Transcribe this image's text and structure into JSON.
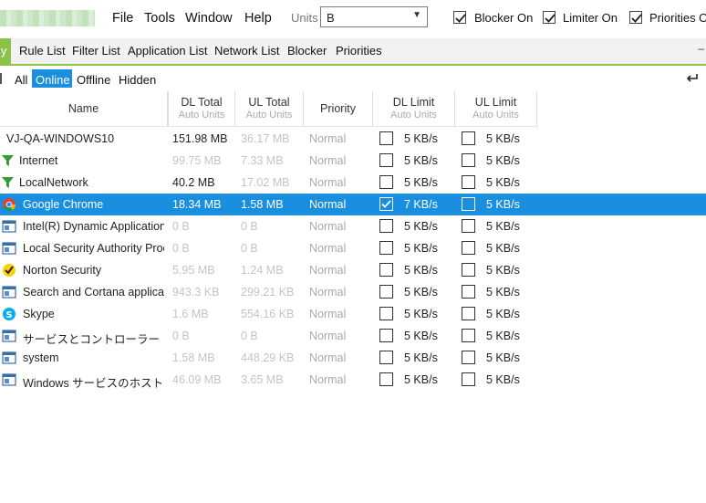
{
  "menu": {
    "file": "File",
    "tools": "Tools",
    "window": "Window",
    "help": "Help"
  },
  "units": {
    "label": "Units",
    "value": "B"
  },
  "toggles": {
    "blocker": "Blocker On",
    "limiter": "Limiter On",
    "priorities": "Priorities On"
  },
  "tabs": {
    "active_fragment": "y",
    "items": [
      "Rule List",
      "Filter List",
      "Application List",
      "Network List",
      "Blocker",
      "Priorities"
    ]
  },
  "filters": {
    "all": "All",
    "online": "Online",
    "offline": "Offline",
    "hidden": "Hidden"
  },
  "columns": {
    "name": "Name",
    "dl_total": "DL Total",
    "dl_total_sub": "Auto Units",
    "ul_total": "UL Total",
    "ul_total_sub": "Auto Units",
    "priority": "Priority",
    "dl_limit": "DL Limit",
    "dl_limit_sub": "Auto Units",
    "ul_limit": "UL Limit",
    "ul_limit_sub": "Auto Units"
  },
  "rows": [
    {
      "name": "VJ-QA-WINDOWS10",
      "icon": "none",
      "dl": "151.98 MB",
      "ul": "36.17 MB",
      "priority": "Normal",
      "dl_checked": false,
      "dl_limit": "5 KB/s",
      "ul_checked": false,
      "ul_limit": "5 KB/s",
      "selected": false,
      "dl_dim": false
    },
    {
      "name": "Internet",
      "icon": "filter-icon",
      "dl": "99.75 MB",
      "ul": "7.33 MB",
      "priority": "Normal",
      "dl_checked": false,
      "dl_limit": "5 KB/s",
      "ul_checked": false,
      "ul_limit": "5 KB/s",
      "selected": false,
      "dl_dim": true
    },
    {
      "name": "LocalNetwork",
      "icon": "filter-icon",
      "dl": "40.2 MB",
      "ul": "17.02 MB",
      "priority": "Normal",
      "dl_checked": false,
      "dl_limit": "5 KB/s",
      "ul_checked": false,
      "ul_limit": "5 KB/s",
      "selected": false,
      "dl_dim": false
    },
    {
      "name": "Google Chrome",
      "icon": "chrome-icon",
      "dl": "18.34 MB",
      "ul": "1.58 MB",
      "priority": "Normal",
      "dl_checked": true,
      "dl_limit": "7 KB/s",
      "ul_checked": false,
      "ul_limit": "5 KB/s",
      "selected": true,
      "dl_dim": false
    },
    {
      "name": "Intel(R) Dynamic Application",
      "icon": "app-window-icon",
      "dl": "0 B",
      "ul": "0 B",
      "priority": "Normal",
      "dl_checked": false,
      "dl_limit": "5 KB/s",
      "ul_checked": false,
      "ul_limit": "5 KB/s",
      "selected": false,
      "dl_dim": true
    },
    {
      "name": "Local Security Authority Proc",
      "icon": "app-window-icon",
      "dl": "0 B",
      "ul": "0 B",
      "priority": "Normal",
      "dl_checked": false,
      "dl_limit": "5 KB/s",
      "ul_checked": false,
      "ul_limit": "5 KB/s",
      "selected": false,
      "dl_dim": true
    },
    {
      "name": "Norton Security",
      "icon": "norton-icon",
      "dl": "5.95 MB",
      "ul": "1.24 MB",
      "priority": "Normal",
      "dl_checked": false,
      "dl_limit": "5 KB/s",
      "ul_checked": false,
      "ul_limit": "5 KB/s",
      "selected": false,
      "dl_dim": true
    },
    {
      "name": "Search and Cortana applicati",
      "icon": "app-window-icon",
      "dl": "943.3 KB",
      "ul": "299.21 KB",
      "priority": "Normal",
      "dl_checked": false,
      "dl_limit": "5 KB/s",
      "ul_checked": false,
      "ul_limit": "5 KB/s",
      "selected": false,
      "dl_dim": true
    },
    {
      "name": "Skype",
      "icon": "skype-icon",
      "dl": "1.6 MB",
      "ul": "554.16 KB",
      "priority": "Normal",
      "dl_checked": false,
      "dl_limit": "5 KB/s",
      "ul_checked": false,
      "ul_limit": "5 KB/s",
      "selected": false,
      "dl_dim": true
    },
    {
      "name": "サービスとコントローラー アプリケーシ",
      "icon": "app-window-icon",
      "dl": "0 B",
      "ul": "0 B",
      "priority": "Normal",
      "dl_checked": false,
      "dl_limit": "5 KB/s",
      "ul_checked": false,
      "ul_limit": "5 KB/s",
      "selected": false,
      "dl_dim": true
    },
    {
      "name": "system",
      "icon": "app-window-icon",
      "dl": "1.58 MB",
      "ul": "448.29 KB",
      "priority": "Normal",
      "dl_checked": false,
      "dl_limit": "5 KB/s",
      "ul_checked": false,
      "ul_limit": "5 KB/s",
      "selected": false,
      "dl_dim": true
    },
    {
      "name": "Windows サービスのホスト プロセ",
      "icon": "app-window-icon",
      "dl": "46.09 MB",
      "ul": "3.65 MB",
      "priority": "Normal",
      "dl_checked": false,
      "dl_limit": "5 KB/s",
      "ul_checked": false,
      "ul_limit": "5 KB/s",
      "selected": false,
      "dl_dim": true
    }
  ],
  "colors": {
    "accent_green": "#8bc34a",
    "selection_blue": "#1a8fe0"
  }
}
